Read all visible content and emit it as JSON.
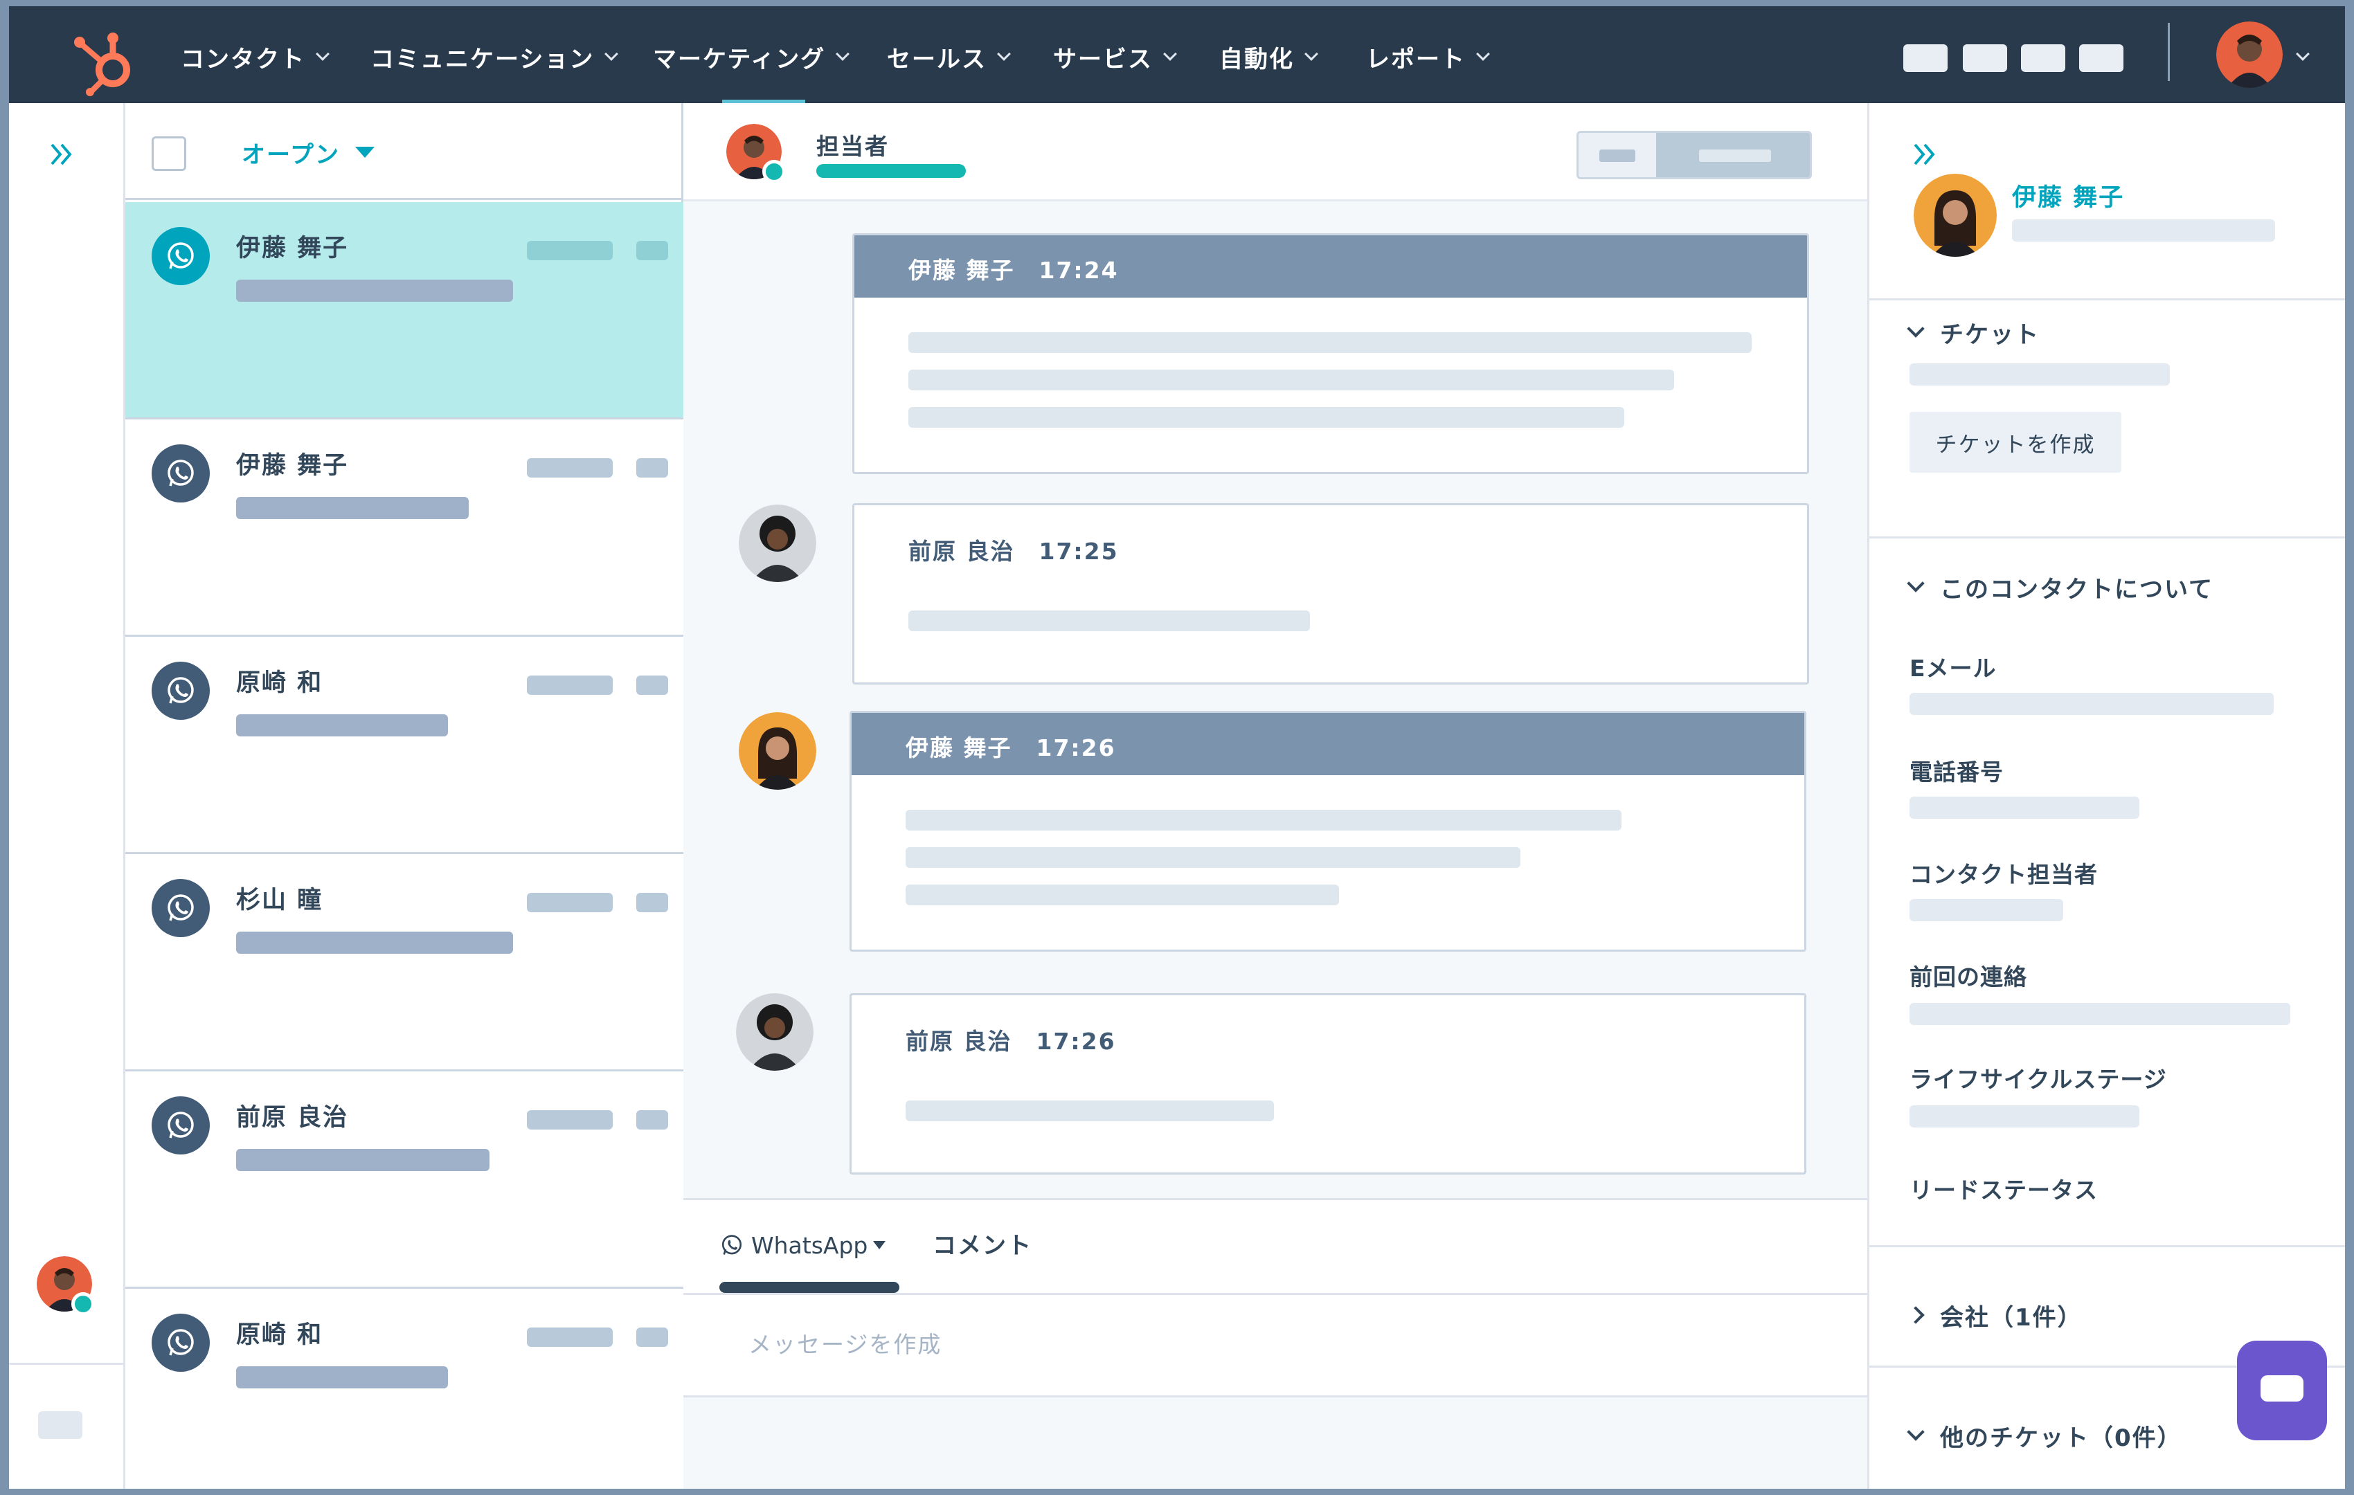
{
  "nav": {
    "items": [
      {
        "label": "コンタクト"
      },
      {
        "label": "コミュニケーション"
      },
      {
        "label": "マーケティング"
      },
      {
        "label": "セールス"
      },
      {
        "label": "サービス"
      },
      {
        "label": "自動化"
      },
      {
        "label": "レポート"
      }
    ],
    "logo_icon": "hubspot-sprocket-icon",
    "brand_color": "#ff7a59",
    "bar_color": "#283a4c"
  },
  "inbox": {
    "filter_label": "オープン",
    "conversations": [
      {
        "name": "伊藤 舞子",
        "channel": "whatsapp",
        "selected": true
      },
      {
        "name": "伊藤 舞子",
        "channel": "whatsapp",
        "selected": false
      },
      {
        "name": "原崎 和",
        "channel": "whatsapp",
        "selected": false
      },
      {
        "name": "杉山 瞳",
        "channel": "whatsapp",
        "selected": false
      },
      {
        "name": "前原 良治",
        "channel": "whatsapp",
        "selected": false
      },
      {
        "name": "原崎 和",
        "channel": "whatsapp",
        "selected": false
      }
    ]
  },
  "chat": {
    "owner_label": "担当者",
    "messages": [
      {
        "header": "伊藤 舞子　17:24",
        "direction": "incoming"
      },
      {
        "header": "前原 良治　17:25",
        "direction": "outgoing"
      },
      {
        "header": "伊藤 舞子　17:26",
        "direction": "incoming"
      },
      {
        "header": "前原 良治　17:26",
        "direction": "outgoing"
      }
    ],
    "composer": {
      "channel_tab": "WhatsApp",
      "comment_tab": "コメント",
      "placeholder": "メッセージを作成"
    }
  },
  "sidebar": {
    "contact_name": "伊藤 舞子",
    "tickets_title": "チケット",
    "create_ticket_label": "チケットを作成",
    "about_title": "このコンタクトについて",
    "properties": [
      {
        "label": "Eメール"
      },
      {
        "label": "電話番号"
      },
      {
        "label": "コンタクト担当者"
      },
      {
        "label": "前回の連絡"
      },
      {
        "label": "ライフサイクルステージ"
      },
      {
        "label": "リードステータス"
      }
    ],
    "company_title": "会社（1件）",
    "other_tickets_title": "他のチケット（0件）"
  },
  "accent_teal": "#00a4bd",
  "chat_fab_color": "#6b56ce"
}
